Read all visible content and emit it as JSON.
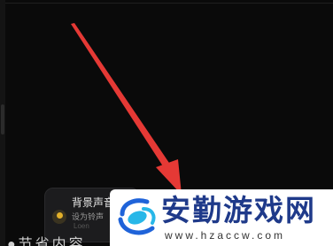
{
  "notification": {
    "title": "背景声音",
    "subtitle": "设为铃声",
    "hint": "Loen",
    "icon": "music-note-icon",
    "accent_color": "#e3b02a"
  },
  "bottom_text": "●节省内容",
  "arrow": {
    "color": "#e53935",
    "icon": "red-arrow-annotation"
  },
  "watermark": {
    "title": "安勤游戏网",
    "url": "www.hzaccw.com",
    "logo": "hzaccw-logo",
    "brand_color": "#1f3a8a"
  }
}
